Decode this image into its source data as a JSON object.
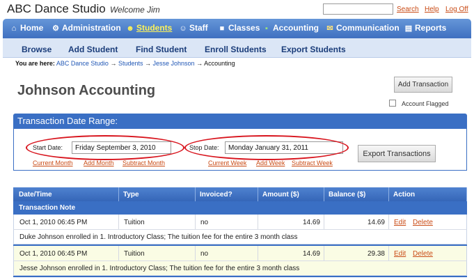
{
  "header": {
    "app_name": "ABC Dance Studio",
    "welcome": "Welcome Jim",
    "search_value": "",
    "links": [
      "Search",
      "Help",
      "Log Off"
    ]
  },
  "nav": {
    "items": [
      {
        "label": "Home",
        "icon": "home-icon"
      },
      {
        "label": "Administration",
        "icon": "gear-icon"
      },
      {
        "label": "Students",
        "icon": "students-icon"
      },
      {
        "label": "Staff",
        "icon": "staff-icon"
      },
      {
        "label": "Classes",
        "icon": "classes-icon"
      },
      {
        "label": "Accounting",
        "icon": "money-icon"
      },
      {
        "label": "Communication",
        "icon": "mail-icon"
      },
      {
        "label": "Reports",
        "icon": "report-icon"
      }
    ],
    "active": "Students"
  },
  "subnav": {
    "items": [
      "Browse",
      "Add Student",
      "Find Student",
      "Enroll Students",
      "Export Students"
    ]
  },
  "breadcrumb": {
    "prefix": "You are here:",
    "items": [
      "ABC Dance Studio",
      "Students",
      "Jesse Johnson"
    ],
    "current": "Accounting",
    "sep": "→"
  },
  "page": {
    "title": "Johnson Accounting",
    "add_transaction": "Add Transaction",
    "account_flagged_label": "Account Flagged",
    "account_flagged": false
  },
  "range": {
    "heading": "Transaction Date Range:",
    "start_label": "Start Date:",
    "start_value": "Friday September 3, 2010",
    "stop_label": "Stop Date:",
    "stop_value": "Monday January 31, 2011",
    "export_label": "Export Transactions",
    "start_links": [
      "Current Month",
      "Add Month",
      "Subtract Month"
    ],
    "stop_links": [
      "Current Week",
      "Add Week",
      "Subtract Week"
    ],
    "highlight_color": "#d8141d"
  },
  "table": {
    "columns": [
      "Date/Time",
      "Type",
      "Invoiced?",
      "Amount ($)",
      "Balance ($)",
      "Action"
    ],
    "note_header": "Transaction Note",
    "rows": [
      {
        "date": "Oct 1, 2010 06:45 PM",
        "type": "Tuition",
        "invoiced": "no",
        "amount": "14.69",
        "balance": "14.69",
        "edit": "Edit",
        "delete": "Delete",
        "note": "Duke Johnson enrolled in 1. Introductory Class; The tuition fee for the entire 3 month class"
      },
      {
        "date": "Oct 1, 2010 06:45 PM",
        "type": "Tuition",
        "invoiced": "no",
        "amount": "14.69",
        "balance": "29.38",
        "edit": "Edit",
        "delete": "Delete",
        "note": "Jesse Johnson enrolled in 1. Introductory Class; The tuition fee for the entire 3 month class"
      }
    ]
  },
  "colors": {
    "nav_blue": "#3f70c0",
    "active_nav": "#fdf35a",
    "link_orange": "#c94a14"
  }
}
